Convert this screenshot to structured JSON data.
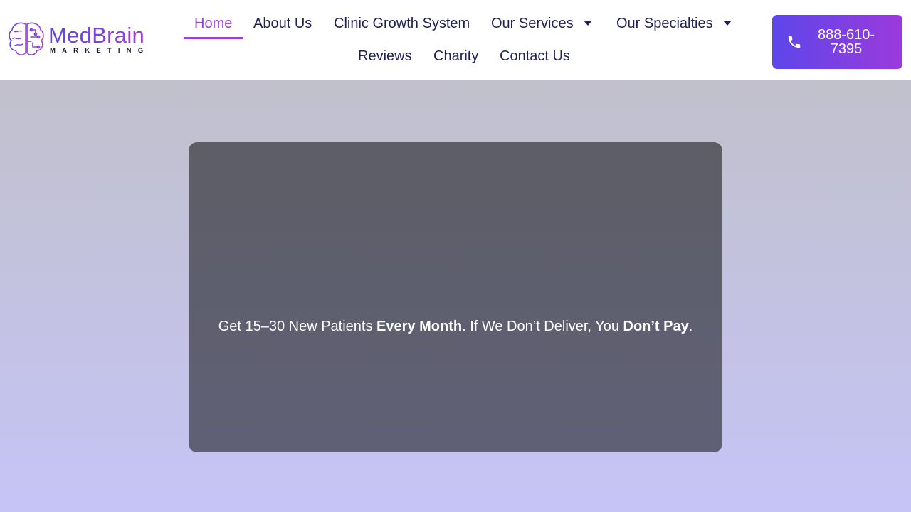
{
  "brand": {
    "name": "MedBrain",
    "tagline": "MARKETING",
    "logo_icon": "brain-icon"
  },
  "nav": {
    "items": [
      {
        "label": "Home",
        "active": true
      },
      {
        "label": "About Us"
      },
      {
        "label": "Clinic Growth System"
      },
      {
        "label": "Our Services",
        "has_dropdown": true
      },
      {
        "label": "Our Specialties",
        "has_dropdown": true
      },
      {
        "label": "Reviews"
      },
      {
        "label": "Charity"
      },
      {
        "label": "Contact Us"
      }
    ]
  },
  "cta": {
    "phone_line1": "888-610-",
    "phone_line2": "7395",
    "icon": "phone-icon"
  },
  "hero": {
    "part1": "Get 15–30 New Patients ",
    "bold1": "Every Month",
    "part2": ". If We Don’t Deliver, You ",
    "bold2": "Don’t Pay",
    "part3": "."
  },
  "colors": {
    "accent_start": "#5d46ea",
    "accent_end": "#9b3adb",
    "nav_text": "#22205a",
    "active_nav": "#9a3fd8"
  }
}
